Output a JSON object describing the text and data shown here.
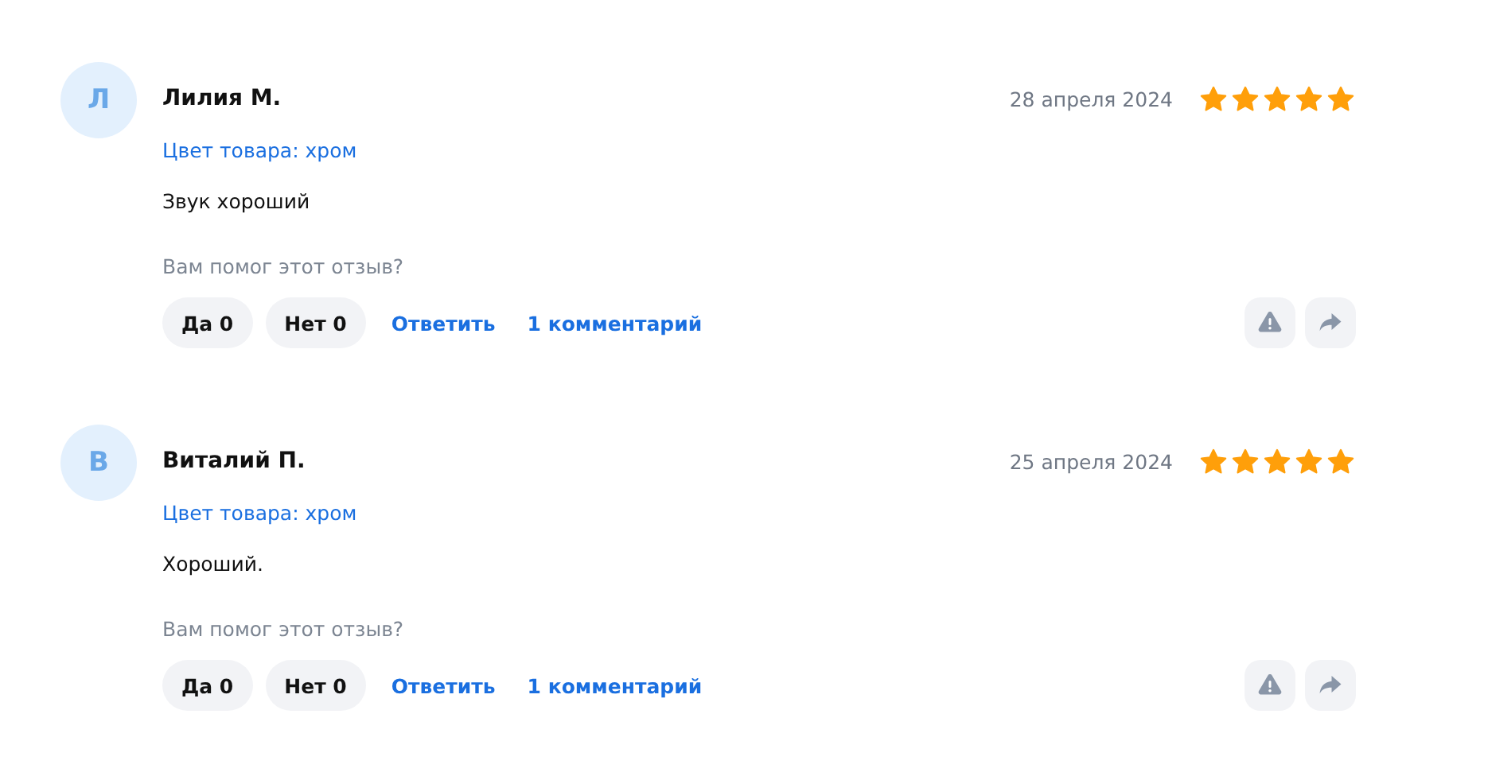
{
  "reviews": [
    {
      "avatar_letter": "Л",
      "author": "Лилия М.",
      "date": "28 апреля 2024",
      "stars": 5,
      "variant": "Цвет товара: хром",
      "text": "Звук хороший",
      "helpful_prompt": "Вам помог этот отзыв?",
      "yes": "Да 0",
      "no": "Нет 0",
      "reply": "Ответить",
      "comments": "1 комментарий"
    },
    {
      "avatar_letter": "В",
      "author": "Виталий П.",
      "date": "25 апреля 2024",
      "stars": 5,
      "variant": "Цвет товара: хром",
      "text": "Хороший.",
      "helpful_prompt": "Вам помог этот отзыв?",
      "yes": "Да 0",
      "no": "Нет 0",
      "reply": "Ответить",
      "comments": "1 комментарий"
    }
  ]
}
